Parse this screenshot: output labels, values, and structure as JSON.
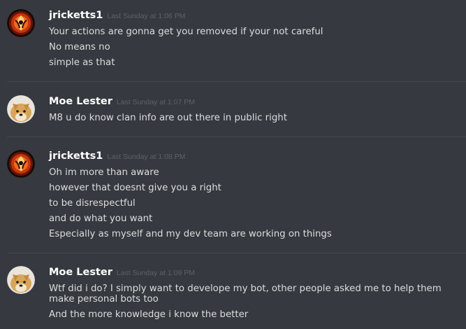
{
  "messages": [
    {
      "author": "jricketts1",
      "avatar_icon": "phoenix-avatar",
      "timestamp": "Last Sunday at 1:06 PM",
      "lines": [
        "Your actions are gonna get you removed if your not careful",
        "No means no",
        "simple as that"
      ]
    },
    {
      "author": "Moe Lester",
      "avatar_icon": "doge-avatar",
      "timestamp": "Last Sunday at 1:07 PM",
      "lines": [
        "M8 u do know clan info are out there in public right"
      ]
    },
    {
      "author": "jricketts1",
      "avatar_icon": "phoenix-avatar",
      "timestamp": "Last Sunday at 1:08 PM",
      "lines": [
        "Oh im more than aware",
        "however that doesnt give you a right",
        "to be disrespectful",
        "and do what you want",
        "Especially as myself and my dev team are working on things"
      ]
    },
    {
      "author": "Moe Lester",
      "avatar_icon": "doge-avatar",
      "timestamp": "Last Sunday at 1:09 PM",
      "lines": [
        "Wtf did i do? I simply want to develope my bot, other people asked me to help them make personal bots too",
        "And the more knowledge i know the better"
      ]
    }
  ],
  "colors": {
    "background": "#36393f",
    "username": "#ffffff",
    "timestamp": "#5d6269",
    "text": "#dcddde",
    "divider": "#43464c"
  }
}
